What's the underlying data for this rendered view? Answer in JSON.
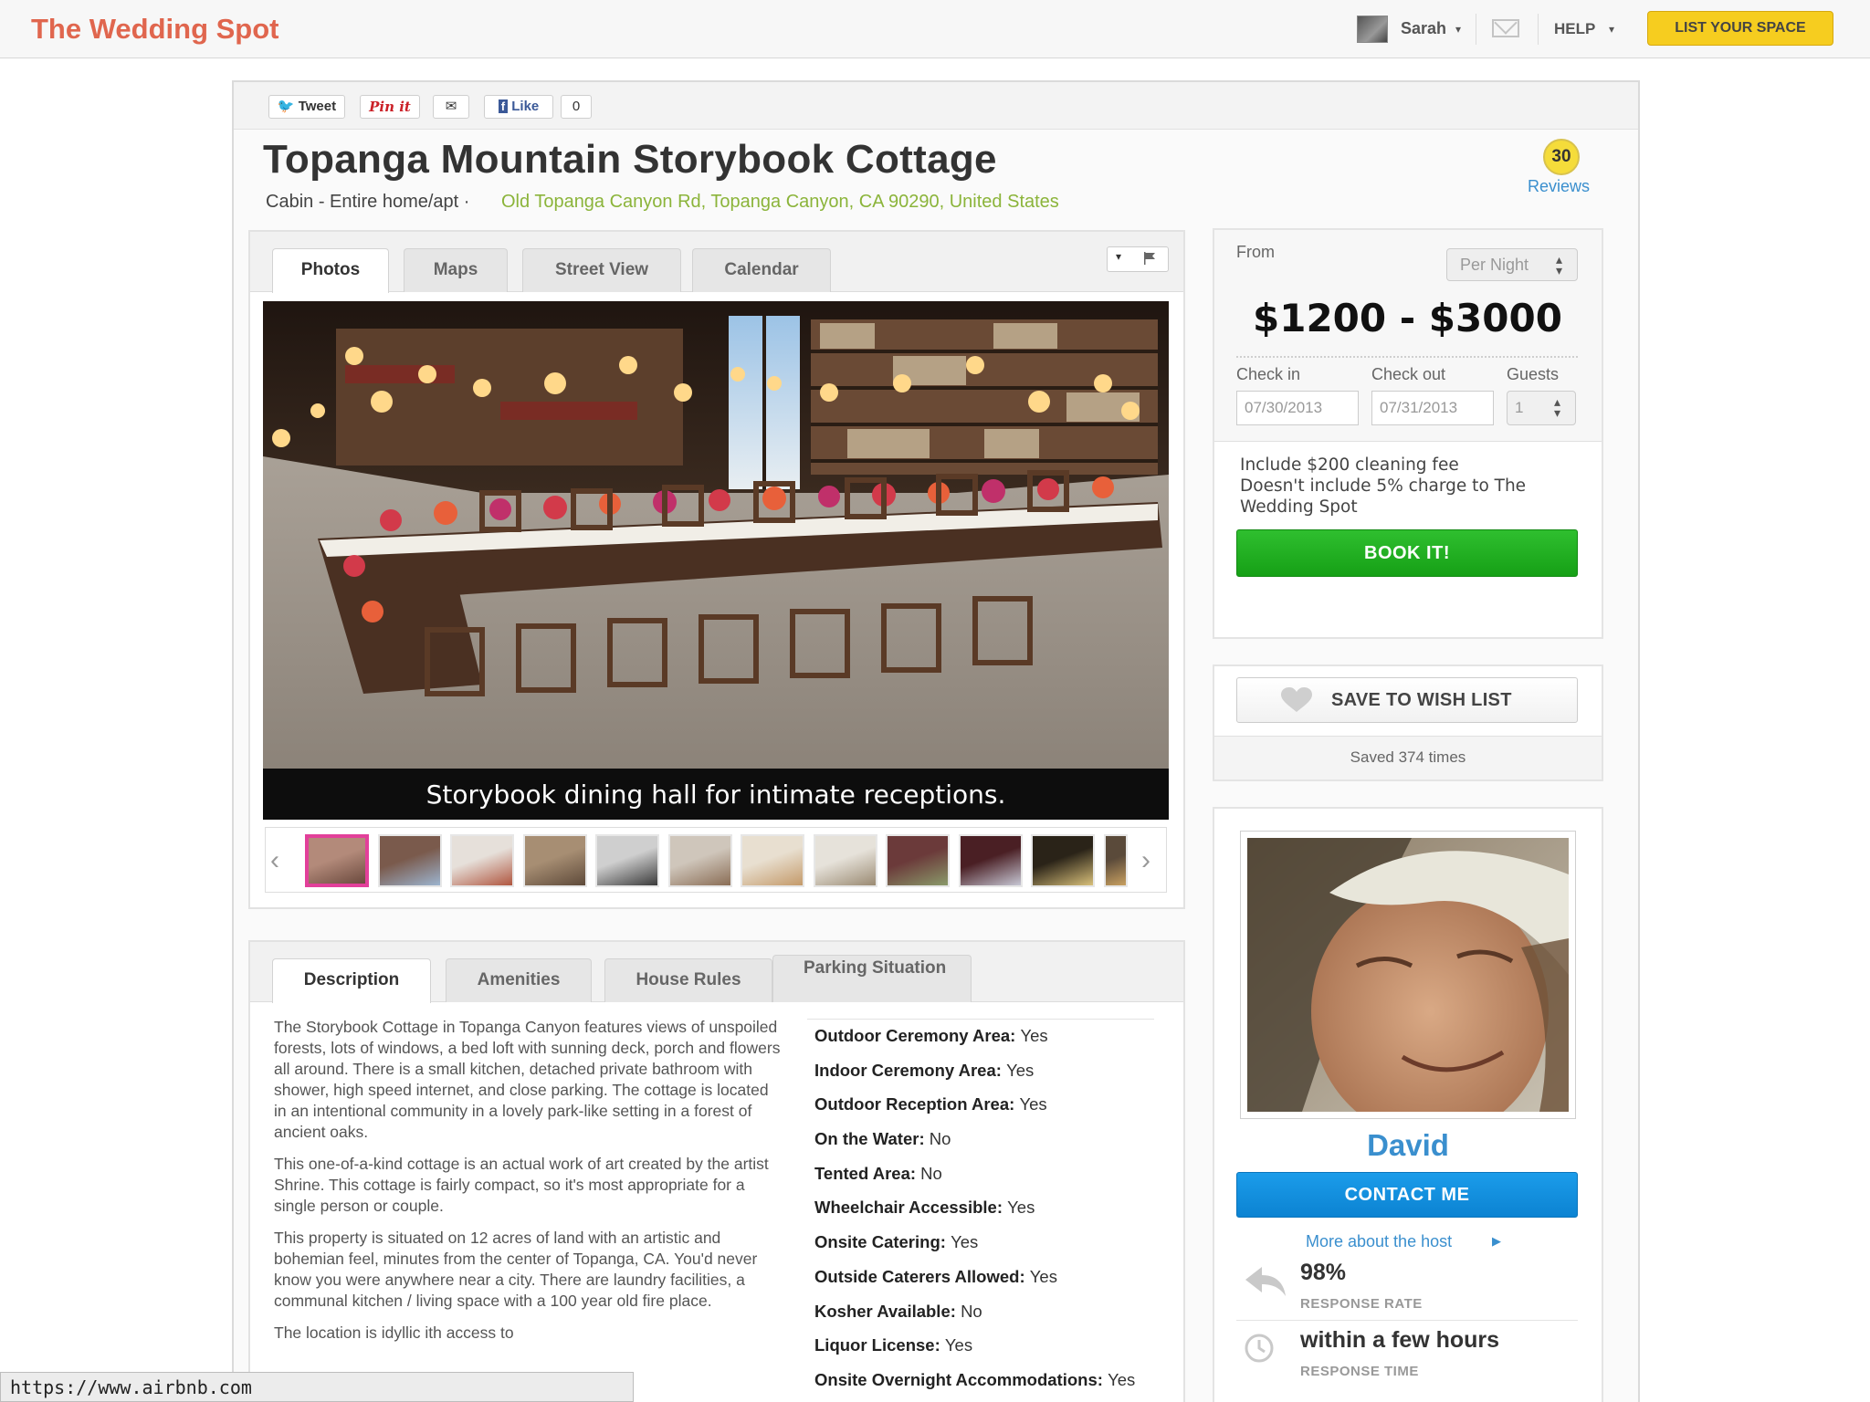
{
  "topbar": {
    "brand": "The Wedding Spot",
    "user_name": "Sarah",
    "help_label": "HELP",
    "list_space_label": "LIST YOUR SPACE"
  },
  "share": {
    "tweet_label": "Tweet",
    "pin_label": "Pin it",
    "like_label": "Like",
    "like_count": "0"
  },
  "listing": {
    "title": "Topanga Mountain Storybook Cottage",
    "type": "Cabin - Entire home/apt ·",
    "address": "Old Topanga Canyon Rd, Topanga Canyon, CA 90290, United States",
    "review_count": "30",
    "reviews_label": "Reviews"
  },
  "photo_tabs": [
    "Photos",
    "Maps",
    "Street View",
    "Calendar"
  ],
  "photo": {
    "caption": "Storybook dining hall for intimate receptions.",
    "thumbnail_count": 12,
    "active_thumbnail": 1
  },
  "detail_tabs": [
    "Description",
    "Amenities",
    "House Rules",
    "Parking Situation"
  ],
  "description": {
    "paragraphs": [
      "The Storybook Cottage in Topanga Canyon features views of unspoiled forests, lots of windows, a bed loft with sunning deck, porch and flowers all around. There is a small kitchen, detached private bathroom with shower, high speed internet, and close parking. The cottage is located in an intentional community in a lovely park-like setting in a forest of ancient oaks.",
      "This one-of-a-kind cottage is an actual work of art created by the artist Shrine. This cottage is fairly compact, so it's most appropriate for a single person or couple.",
      "This property is situated on 12 acres of land with an artistic and bohemian feel, minutes from the center of Topanga, CA. You'd never know you were anywhere near a city. There are laundry facilities, a communal kitchen / living space with a 100 year old fire place.",
      "The location is idyllic ith access to"
    ]
  },
  "amenities": [
    {
      "name": "Outdoor Ceremony Area",
      "value": "Yes"
    },
    {
      "name": "Indoor Ceremony Area",
      "value": "Yes"
    },
    {
      "name": "Outdoor Reception Area",
      "value": "Yes"
    },
    {
      "name": "On the Water",
      "value": "No"
    },
    {
      "name": "Tented Area",
      "value": "No"
    },
    {
      "name": "Wheelchair Accessible",
      "value": "Yes"
    },
    {
      "name": "Onsite Catering",
      "value": "Yes"
    },
    {
      "name": "Outside Caterers Allowed",
      "value": "Yes"
    },
    {
      "name": "Kosher Available",
      "value": "No"
    },
    {
      "name": "Liquor License",
      "value": "Yes"
    },
    {
      "name": "Onsite Overnight Accommodations",
      "value": "Yes"
    }
  ],
  "booking": {
    "from_label": "From",
    "rate_option": "Per Night",
    "price_range": "$1200 - $3000",
    "checkin_label": "Check in",
    "checkout_label": "Check out",
    "guests_label": "Guests",
    "checkin_value": "07/30/2013",
    "checkout_value": "07/31/2013",
    "guests_value": "1",
    "fee_line_1": "Include $200 cleaning fee",
    "fee_line_2": "Doesn't include 5% charge to The Wedding Spot",
    "book_label": "BOOK IT!"
  },
  "wishlist": {
    "button_label": "SAVE TO WISH LIST",
    "saved_text": "Saved 374 times"
  },
  "host": {
    "name": "David",
    "contact_label": "CONTACT ME",
    "more_label": "More about the host",
    "response_rate": "98%",
    "response_rate_label": "RESPONSE RATE",
    "response_time": "within a few hours",
    "response_time_label": "RESPONSE TIME"
  },
  "status_url": "https://www.airbnb.com",
  "colors": {
    "brand": "#e0664e",
    "address_green": "#8bb43a",
    "link_blue": "#3a8fce",
    "book_green": "#16a016",
    "contact_blue": "#0c83d2",
    "list_space_yellow": "#f6cd1f",
    "active_thumb_border": "#e2409a"
  }
}
